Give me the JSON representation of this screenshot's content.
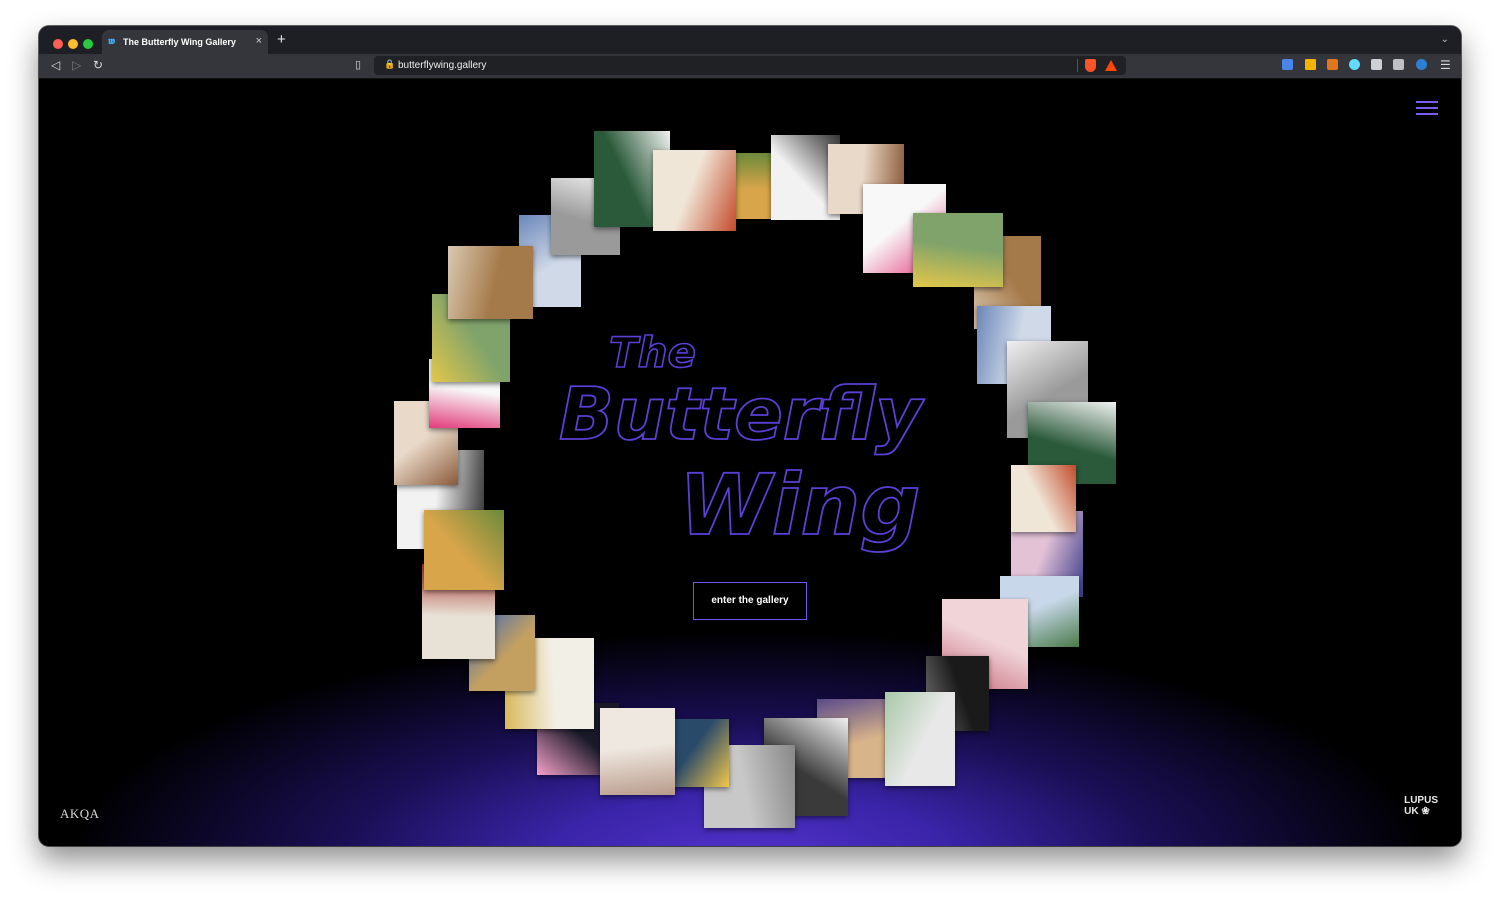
{
  "browser": {
    "tab_title": "The Butterfly Wing Gallery",
    "tab_close": "×",
    "new_tab": "+",
    "url": "butterflywing.gallery",
    "nav": {
      "back": "◁",
      "forward": "▷",
      "reload": "↻"
    }
  },
  "page": {
    "title_line1": "The",
    "title_line2": "Butterfly",
    "title_line3": "Wing",
    "enter_button": "enter the gallery",
    "footer_left_logo": "AKQA",
    "footer_right_logo_line1": "LUPUS",
    "footer_right_logo_line2": "UK"
  },
  "colors": {
    "accent": "#6f55e8",
    "title_stroke": "#5b3fd6",
    "glow": "#4a2fc4",
    "background": "#000000"
  },
  "icons": [
    "back-icon",
    "forward-icon",
    "reload-icon",
    "bookmark-icon",
    "lock-icon",
    "brave-shield-icon",
    "brave-rewards-icon",
    "translate-icon",
    "extensions-icon",
    "wallet-icon",
    "menu-icon"
  ]
}
